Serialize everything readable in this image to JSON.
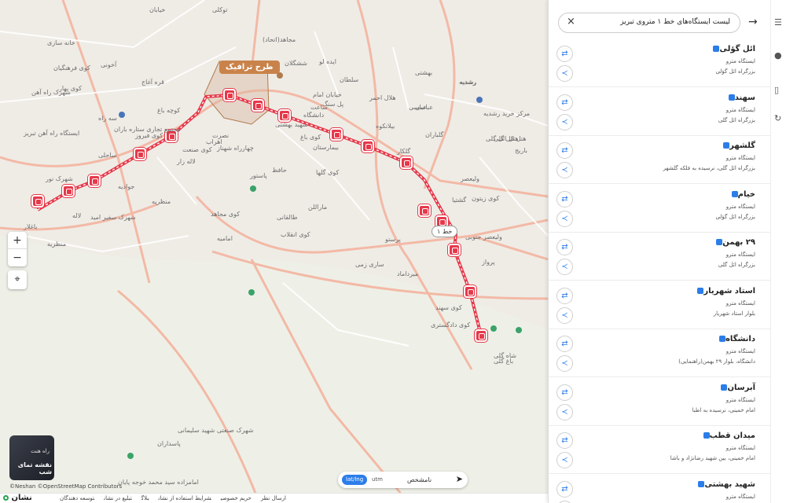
{
  "map": {
    "traffic_label": "طرح ترافیک",
    "line_badge": "خط ۱",
    "zoom_in": "+",
    "zoom_out": "−",
    "night_map": {
      "top_text": "راه هنت",
      "label": "نقشه تمای شب"
    },
    "attribution": "©Neshan ©OpenStreetMap Contributors",
    "labels": [
      "توکلی",
      "خیابان",
      "خانه سازی",
      "آخونی",
      "کوی فرهنگیان",
      "کوی بهار",
      "قره آغاج",
      "شهرک راه آهن",
      "کوچه باغ",
      "کوی فیروز",
      "ایستگاه راه آهن تبریز",
      "سه راه",
      "مجتمع تجاری ستاره باران",
      "لاله زار",
      "اهراب",
      "چهارراه شهناز",
      "ساحلی",
      "شهرک نور",
      "جوادیه",
      "نصرت",
      "منظریه",
      "کوی مجاهد",
      "پاستور",
      "حافظ",
      "شهرک سفیر امید",
      "لاله",
      "باغلار",
      "امامیه",
      "طالقانی",
      "کوی انقلاب",
      "ماراللن",
      "کوی گلها",
      "کوی باغ",
      "سلطان",
      "ایده لو",
      "ششگلان",
      "مجاهد(اتحاد)",
      "ساری زمی",
      "میرداماد",
      "گلکار",
      "گلباران",
      "ولیعصر",
      "ولیعصر جنوبی",
      "پرواز",
      "کوی سهند",
      "کوی دادگستری",
      "شاه گلی",
      "باغ گلی",
      "بیمارستان",
      "عباسی",
      "بیلانکوه",
      "بهشتی",
      "رشدیه",
      "مرکز خرید رشدیه",
      "هتل ائل گلی",
      "باریج",
      "خیابان امام",
      "ساعت",
      "شهید بهشتی",
      "دانشگاه",
      "کوی زیتون",
      "پرستو",
      "شهرک صنعتی شهید سلیمانی",
      "امامزاده سید محمد خوجه پایان",
      "گشتیا",
      "پل سنگ",
      "منظریه",
      "کوی صنعت",
      "هلال احمر",
      "پاسداران",
      "عباسی",
      "رشدیه",
      "هتل ائل گلی"
    ]
  },
  "coords": {
    "latlng": "lat/lng",
    "utm": "utm",
    "unknown": "نامشخص"
  },
  "footer": {
    "links": [
      "ارسال نظر",
      "حریم خصوصی",
      "شرایط استفاده از نشان",
      "بلاگ",
      "تبلیغ در نشان",
      "توسعه دهندگان"
    ],
    "brand": "نشان"
  },
  "panel": {
    "query": "لیست ایستگاه‌های خط ۱ متروی تبریز",
    "clear": "×",
    "back": "→",
    "stations": [
      {
        "name": "ائل گؤلی",
        "type": "ایستگاه مترو",
        "addr": "بزرگراه ائل گؤلی"
      },
      {
        "name": "سهند",
        "type": "ایستگاه مترو",
        "addr": "بزرگراه ائل گلی"
      },
      {
        "name": "گلشهر",
        "type": "ایستگاه مترو",
        "addr": "بزرگراه ائل گلی، نرسیده به فلکه گلشهر"
      },
      {
        "name": "خیام",
        "type": "ایستگاه مترو",
        "addr": "بزرگراه ائل گؤلی"
      },
      {
        "name": "۲۹ بهمن",
        "type": "ایستگاه مترو",
        "addr": "بزرگراه ائل گلی"
      },
      {
        "name": "استاد شهریار",
        "type": "ایستگاه مترو",
        "addr": "بلوار استاد شهریار"
      },
      {
        "name": "دانشگاه",
        "type": "ایستگاه مترو",
        "addr": "دانشگاه، بلوار ۲۹ بهمن(راهنمایی)"
      },
      {
        "name": "آبرسان",
        "type": "ایستگاه مترو",
        "addr": "امام خمینی، نرسیده به اطبا"
      },
      {
        "name": "میدان قطب",
        "type": "ایستگاه مترو",
        "addr": "امام خمینی، بین شهید رضانژاد و باشا"
      },
      {
        "name": "شهید بهشتی",
        "type": "ایستگاه مترو",
        "addr": ""
      }
    ]
  },
  "colors": {
    "metro_line": "#e5394a",
    "accent": "#2b7de9",
    "traffic_zone": "#c9834a"
  }
}
